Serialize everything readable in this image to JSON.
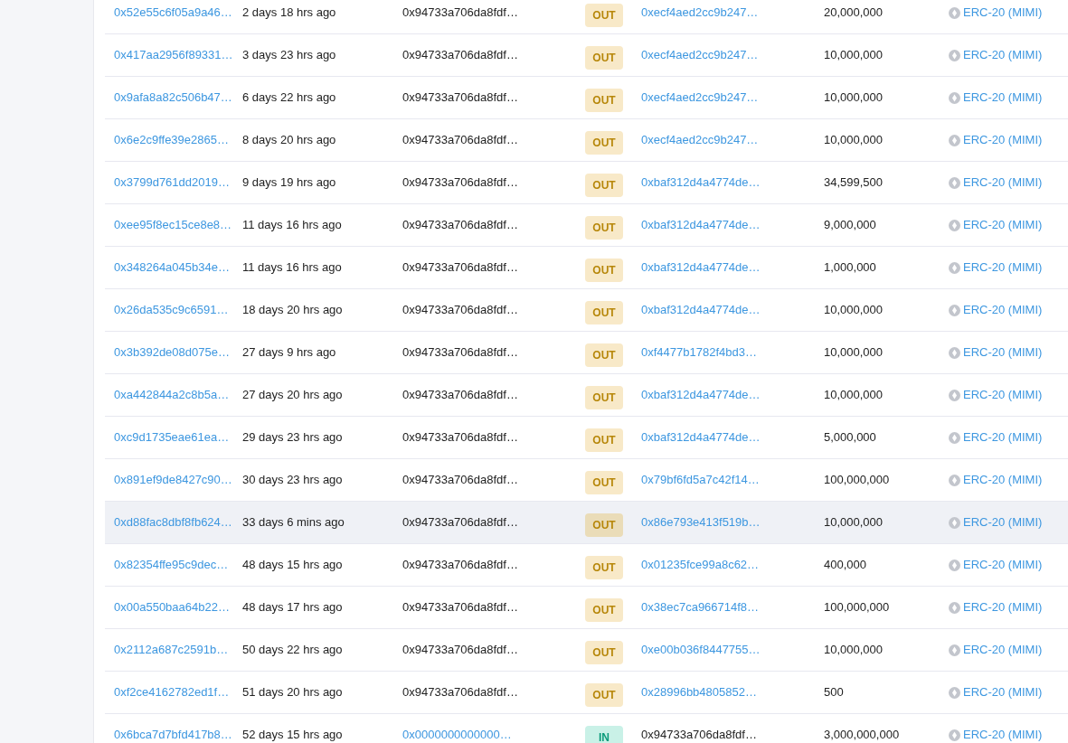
{
  "rows": [
    {
      "hash": "0x52e55c6f05a9a46…",
      "age": "2 days 18 hrs ago",
      "from": {
        "text": "0x94733a706da8fdf…",
        "link": false
      },
      "direction": {
        "kind": "out",
        "label": "OUT"
      },
      "to": {
        "text": "0xecf4aed2cc9b247…",
        "link": true
      },
      "amount": "20,000,000",
      "token": "ERC-20 (MIMI)",
      "highlighted": false
    },
    {
      "hash": "0x417aa2956f89331…",
      "age": "3 days 23 hrs ago",
      "from": {
        "text": "0x94733a706da8fdf…",
        "link": false
      },
      "direction": {
        "kind": "out",
        "label": "OUT"
      },
      "to": {
        "text": "0xecf4aed2cc9b247…",
        "link": true
      },
      "amount": "10,000,000",
      "token": "ERC-20 (MIMI)",
      "highlighted": false
    },
    {
      "hash": "0x9afa8a82c506b47…",
      "age": "6 days 22 hrs ago",
      "from": {
        "text": "0x94733a706da8fdf…",
        "link": false
      },
      "direction": {
        "kind": "out",
        "label": "OUT"
      },
      "to": {
        "text": "0xecf4aed2cc9b247…",
        "link": true
      },
      "amount": "10,000,000",
      "token": "ERC-20 (MIMI)",
      "highlighted": false
    },
    {
      "hash": "0x6e2c9ffe39e2865…",
      "age": "8 days 20 hrs ago",
      "from": {
        "text": "0x94733a706da8fdf…",
        "link": false
      },
      "direction": {
        "kind": "out",
        "label": "OUT"
      },
      "to": {
        "text": "0xecf4aed2cc9b247…",
        "link": true
      },
      "amount": "10,000,000",
      "token": "ERC-20 (MIMI)",
      "highlighted": false
    },
    {
      "hash": "0x3799d761dd2019…",
      "age": "9 days 19 hrs ago",
      "from": {
        "text": "0x94733a706da8fdf…",
        "link": false
      },
      "direction": {
        "kind": "out",
        "label": "OUT"
      },
      "to": {
        "text": "0xbaf312d4a4774de…",
        "link": true
      },
      "amount": "34,599,500",
      "token": "ERC-20 (MIMI)",
      "highlighted": false
    },
    {
      "hash": "0xee95f8ec15ce8e8…",
      "age": "11 days 16 hrs ago",
      "from": {
        "text": "0x94733a706da8fdf…",
        "link": false
      },
      "direction": {
        "kind": "out",
        "label": "OUT"
      },
      "to": {
        "text": "0xbaf312d4a4774de…",
        "link": true
      },
      "amount": "9,000,000",
      "token": "ERC-20 (MIMI)",
      "highlighted": false
    },
    {
      "hash": "0x348264a045b34e…",
      "age": "11 days 16 hrs ago",
      "from": {
        "text": "0x94733a706da8fdf…",
        "link": false
      },
      "direction": {
        "kind": "out",
        "label": "OUT"
      },
      "to": {
        "text": "0xbaf312d4a4774de…",
        "link": true
      },
      "amount": "1,000,000",
      "token": "ERC-20 (MIMI)",
      "highlighted": false
    },
    {
      "hash": "0x26da535c9c6591…",
      "age": "18 days 20 hrs ago",
      "from": {
        "text": "0x94733a706da8fdf…",
        "link": false
      },
      "direction": {
        "kind": "out",
        "label": "OUT"
      },
      "to": {
        "text": "0xbaf312d4a4774de…",
        "link": true
      },
      "amount": "10,000,000",
      "token": "ERC-20 (MIMI)",
      "highlighted": false
    },
    {
      "hash": "0x3b392de08d075e…",
      "age": "27 days 9 hrs ago",
      "from": {
        "text": "0x94733a706da8fdf…",
        "link": false
      },
      "direction": {
        "kind": "out",
        "label": "OUT"
      },
      "to": {
        "text": "0xf4477b1782f4bd3…",
        "link": true
      },
      "amount": "10,000,000",
      "token": "ERC-20 (MIMI)",
      "highlighted": false
    },
    {
      "hash": "0xa442844a2c8b5a…",
      "age": "27 days 20 hrs ago",
      "from": {
        "text": "0x94733a706da8fdf…",
        "link": false
      },
      "direction": {
        "kind": "out",
        "label": "OUT"
      },
      "to": {
        "text": "0xbaf312d4a4774de…",
        "link": true
      },
      "amount": "10,000,000",
      "token": "ERC-20 (MIMI)",
      "highlighted": false
    },
    {
      "hash": "0xc9d1735eae61ea…",
      "age": "29 days 23 hrs ago",
      "from": {
        "text": "0x94733a706da8fdf…",
        "link": false
      },
      "direction": {
        "kind": "out",
        "label": "OUT"
      },
      "to": {
        "text": "0xbaf312d4a4774de…",
        "link": true
      },
      "amount": "5,000,000",
      "token": "ERC-20 (MIMI)",
      "highlighted": false
    },
    {
      "hash": "0x891ef9de8427c90…",
      "age": "30 days 23 hrs ago",
      "from": {
        "text": "0x94733a706da8fdf…",
        "link": false
      },
      "direction": {
        "kind": "out",
        "label": "OUT"
      },
      "to": {
        "text": "0x79bf6fd5a7c42f14…",
        "link": true
      },
      "amount": "100,000,000",
      "token": "ERC-20 (MIMI)",
      "highlighted": false
    },
    {
      "hash": "0xd88fac8dbf8fb624…",
      "age": "33 days 6 mins ago",
      "from": {
        "text": "0x94733a706da8fdf…",
        "link": false
      },
      "direction": {
        "kind": "out",
        "label": "OUT"
      },
      "to": {
        "text": "0x86e793e413f519b…",
        "link": true
      },
      "amount": "10,000,000",
      "token": "ERC-20 (MIMI)",
      "highlighted": true
    },
    {
      "hash": "0x82354ffe95c9dec…",
      "age": "48 days 15 hrs ago",
      "from": {
        "text": "0x94733a706da8fdf…",
        "link": false
      },
      "direction": {
        "kind": "out",
        "label": "OUT"
      },
      "to": {
        "text": "0x01235fce99a8c62…",
        "link": true
      },
      "amount": "400,000",
      "token": "ERC-20 (MIMI)",
      "highlighted": false
    },
    {
      "hash": "0x00a550baa64b22…",
      "age": "48 days 17 hrs ago",
      "from": {
        "text": "0x94733a706da8fdf…",
        "link": false
      },
      "direction": {
        "kind": "out",
        "label": "OUT"
      },
      "to": {
        "text": "0x38ec7ca966714f8…",
        "link": true
      },
      "amount": "100,000,000",
      "token": "ERC-20 (MIMI)",
      "highlighted": false
    },
    {
      "hash": "0x2112a687c2591b…",
      "age": "50 days 22 hrs ago",
      "from": {
        "text": "0x94733a706da8fdf…",
        "link": false
      },
      "direction": {
        "kind": "out",
        "label": "OUT"
      },
      "to": {
        "text": "0xe00b036f8447755…",
        "link": true
      },
      "amount": "10,000,000",
      "token": "ERC-20 (MIMI)",
      "highlighted": false
    },
    {
      "hash": "0xf2ce4162782ed1f…",
      "age": "51 days 20 hrs ago",
      "from": {
        "text": "0x94733a706da8fdf…",
        "link": false
      },
      "direction": {
        "kind": "out",
        "label": "OUT"
      },
      "to": {
        "text": "0x28996bb4805852…",
        "link": true
      },
      "amount": "500",
      "token": "ERC-20 (MIMI)",
      "highlighted": false
    },
    {
      "hash": "0x6bca7d7bfd417b8…",
      "age": "52 days 15 hrs ago",
      "from": {
        "text": "0x0000000000000…",
        "link": true
      },
      "direction": {
        "kind": "in",
        "label": "IN"
      },
      "to": {
        "text": "0x94733a706da8fdf…",
        "link": false
      },
      "amount": "3,000,000,000",
      "token": "ERC-20 (MIMI)",
      "highlighted": false
    }
  ]
}
